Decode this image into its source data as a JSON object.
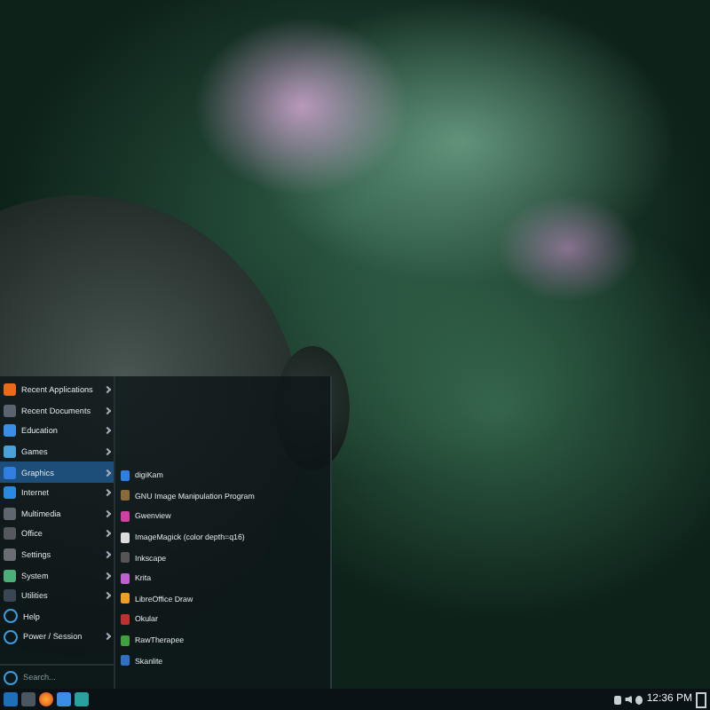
{
  "menu": {
    "categories": [
      {
        "label": "Recent Applications",
        "kind": "app",
        "has_submenu": true,
        "selected": false
      },
      {
        "label": "Recent Documents",
        "kind": "app",
        "has_submenu": true,
        "selected": false
      },
      {
        "label": "Education",
        "kind": "app",
        "has_submenu": true,
        "selected": false
      },
      {
        "label": "Games",
        "kind": "app",
        "has_submenu": true,
        "selected": false
      },
      {
        "label": "Graphics",
        "kind": "app",
        "has_submenu": true,
        "selected": true
      },
      {
        "label": "Internet",
        "kind": "app",
        "has_submenu": true,
        "selected": false
      },
      {
        "label": "Multimedia",
        "kind": "app",
        "has_submenu": true,
        "selected": false
      },
      {
        "label": "Office",
        "kind": "app",
        "has_submenu": true,
        "selected": false
      },
      {
        "label": "Settings",
        "kind": "app",
        "has_submenu": true,
        "selected": false
      },
      {
        "label": "System",
        "kind": "app",
        "has_submenu": true,
        "selected": false
      },
      {
        "label": "Utilities",
        "kind": "app",
        "has_submenu": true,
        "selected": false
      },
      {
        "label": "Help",
        "kind": "action",
        "has_submenu": false,
        "selected": false
      },
      {
        "label": "Power / Session",
        "kind": "action",
        "has_submenu": true,
        "selected": false
      }
    ],
    "search": {
      "placeholder": "Search..."
    },
    "submenu": [
      {
        "label": "digiKam"
      },
      {
        "label": "GNU Image Manipulation Program"
      },
      {
        "label": "Gwenview"
      },
      {
        "label": "ImageMagick (color depth=q16)"
      },
      {
        "label": "Inkscape"
      },
      {
        "label": "Krita"
      },
      {
        "label": "LibreOffice Draw"
      },
      {
        "label": "Okular"
      },
      {
        "label": "RawTherapee"
      },
      {
        "label": "Skanlite"
      }
    ]
  },
  "taskbar": {
    "clock": "12:36 PM"
  }
}
